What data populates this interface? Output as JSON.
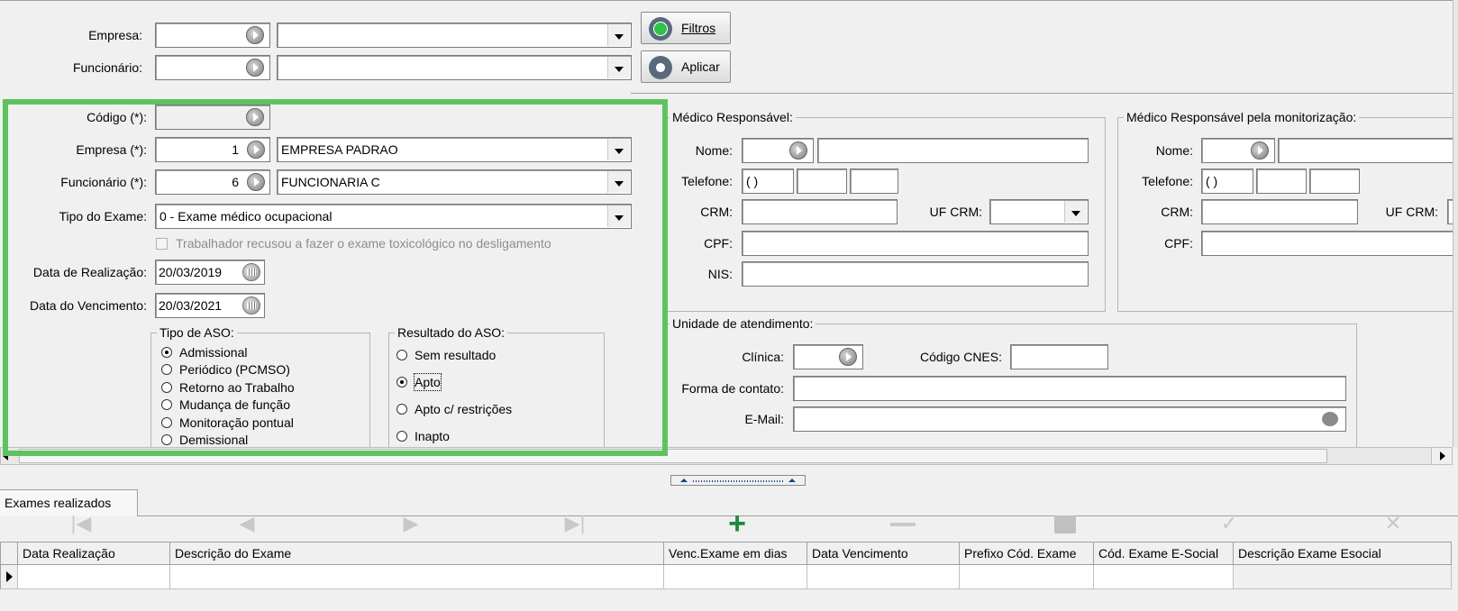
{
  "filters": {
    "empresa_label": "Empresa:",
    "funcionario_label": "Funcionário:",
    "filtros_button": "Filtros",
    "aplicar_button": "Aplicar"
  },
  "form": {
    "codigo_label": "Código (*):",
    "empresa_label": "Empresa (*):",
    "empresa_code": "1",
    "empresa_name": "EMPRESA PADRAO",
    "funcionario_label": "Funcionário (*):",
    "funcionario_code": "6",
    "funcionario_name": "FUNCIONARIA C",
    "tipo_exame_label": "Tipo do Exame:",
    "tipo_exame_value": "0 - Exame médico ocupacional",
    "toxicologico_checkbox": "Trabalhador recusou a fazer o exame toxicológico no desligamento",
    "data_realizacao_label": "Data de Realização:",
    "data_realizacao_value": "20/03/2019",
    "data_vencimento_label": "Data do Vencimento:",
    "data_vencimento_value": "20/03/2021",
    "tipo_aso": {
      "title": "Tipo de ASO:",
      "options": [
        "Admissional",
        "Periódico (PCMSO)",
        "Retorno ao Trabalho",
        "Mudança de função",
        "Monitoração pontual",
        "Demissional"
      ],
      "selected": "Admissional"
    },
    "resultado_aso": {
      "title": "Resultado do ASO:",
      "options": [
        "Sem resultado",
        "Apto",
        "Apto c/ restrições",
        "Inapto"
      ],
      "selected": "Apto"
    }
  },
  "medico": {
    "title": "Médico Responsável:",
    "nome_label": "Nome:",
    "telefone_label": "Telefone:",
    "telefone_placeholder": "(   )",
    "crm_label": "CRM:",
    "uf_crm_label": "UF CRM:",
    "cpf_label": "CPF:",
    "nis_label": "NIS:"
  },
  "medico_monitor": {
    "title": "Médico Responsável pela monitorização:",
    "nome_label": "Nome:",
    "telefone_label": "Telefone:",
    "telefone_placeholder": "(   )",
    "crm_label": "CRM:",
    "uf_crm_label": "UF CRM:",
    "cpf_label": "CPF:"
  },
  "unidade": {
    "title": "Unidade de atendimento:",
    "clinica_label": "Clínica:",
    "cnes_label": "Código CNES:",
    "forma_contato_label": "Forma de contato:",
    "email_label": "E-Mail:"
  },
  "tabs": {
    "exames_realizados": "Exames realizados"
  },
  "grid": {
    "columns": [
      "Data Realização",
      "Descrição do Exame",
      "Venc.Exame em dias",
      "Data Vencimento",
      "Prefixo Cód. Exame",
      "Cód. Exame E-Social",
      "Descrição Exame Esocial"
    ]
  },
  "colors": {
    "highlight_border": "#5ec35e",
    "add_icon": "#1e8a3a"
  }
}
